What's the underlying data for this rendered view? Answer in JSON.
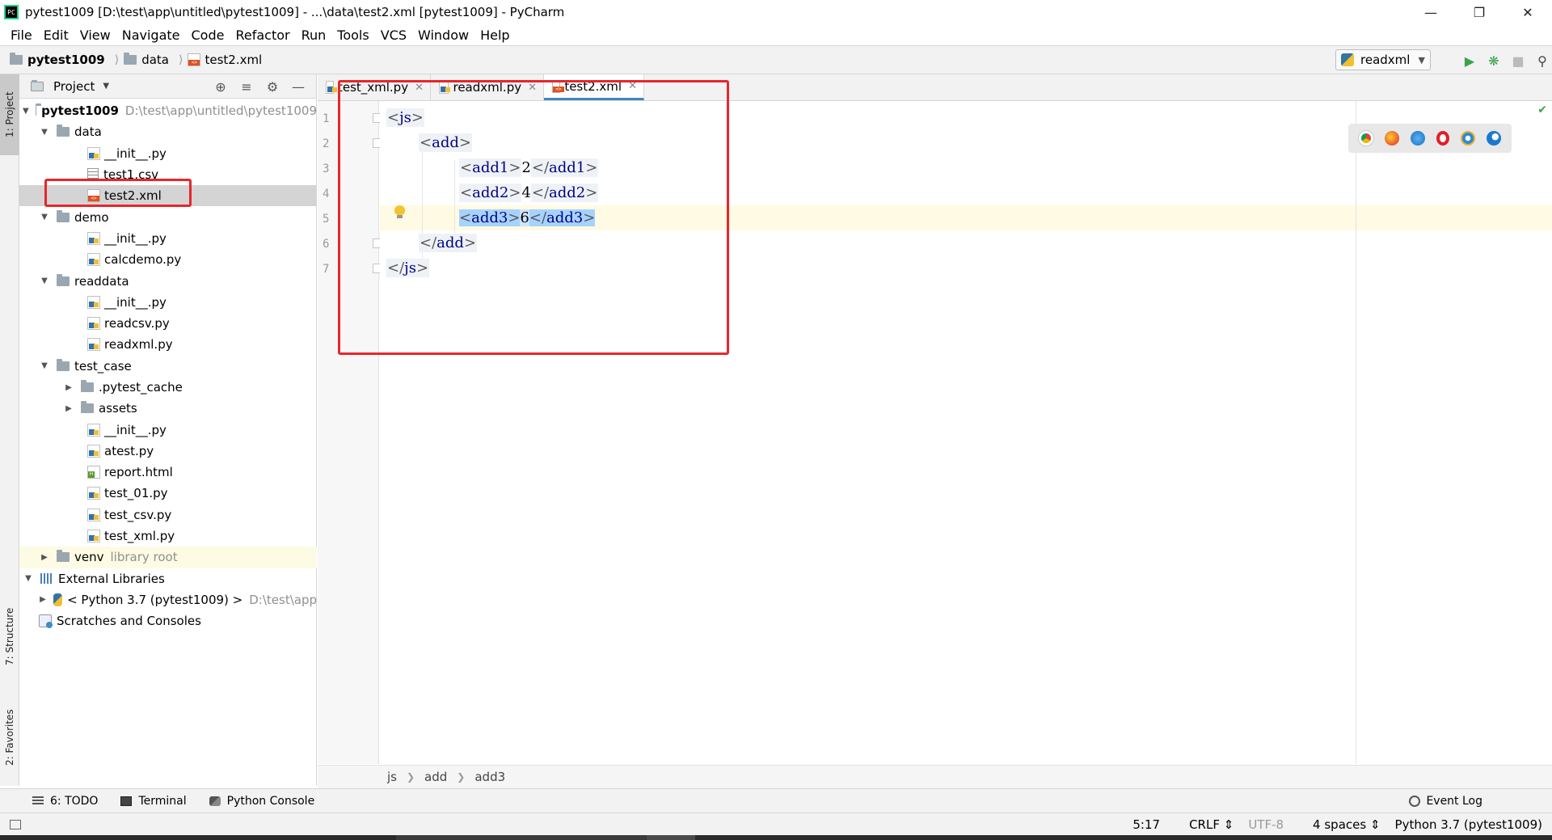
{
  "window": {
    "title": "pytest1009 [D:\\test\\app\\untitled\\pytest1009] - ...\\data\\test2.xml [pytest1009] - PyCharm",
    "app_icon": "PC",
    "controls": [
      "minimize-icon",
      "restore-icon",
      "close-icon"
    ]
  },
  "menu": [
    "File",
    "Edit",
    "View",
    "Navigate",
    "Code",
    "Refactor",
    "Run",
    "Tools",
    "VCS",
    "Window",
    "Help"
  ],
  "navbar": {
    "crumbs": [
      "pytest1009",
      "data",
      "test2.xml"
    ],
    "run_config": "readxml"
  },
  "left_strip": {
    "project": "1: Project",
    "structure": "7: Structure",
    "favorites": "2: Favorites"
  },
  "project_panel": {
    "title": "Project",
    "tree": {
      "root": "pytest1009",
      "root_path": "D:\\test\\app\\untitled\\pytest1009",
      "data": "data",
      "data_init": "__init__.py",
      "data_csv": "test1.csv",
      "data_xml": "test2.xml",
      "demo": "demo",
      "demo_init": "__init__.py",
      "demo_calc": "calcdemo.py",
      "readdata": "readdata",
      "readdata_init": "__init__.py",
      "readdata_csv": "readcsv.py",
      "readdata_xml": "readxml.py",
      "test_case": "test_case",
      "pytest_cache": ".pytest_cache",
      "assets": "assets",
      "tc_init": "__init__.py",
      "atest": "atest.py",
      "report": "report.html",
      "test01": "test_01.py",
      "testcsv": "test_csv.py",
      "testxml": "test_xml.py",
      "venv": "venv",
      "venv_note": "library root",
      "ext_libs": "External Libraries",
      "python": "< Python 3.7 (pytest1009) >",
      "python_path": "D:\\test\\app",
      "scratches": "Scratches and Consoles"
    }
  },
  "editor": {
    "tabs": [
      "test_xml.py",
      "readxml.py",
      "test2.xml"
    ],
    "active_tab": "test2.xml",
    "line_numbers": [
      "1",
      "2",
      "3",
      "4",
      "5",
      "6",
      "7"
    ],
    "code": {
      "l1_open": "<",
      "l1_tag": "js",
      "l1_close": ">",
      "l2_tag": "add",
      "l3_tag": "add1",
      "l3_val": "2",
      "l4_tag": "add2",
      "l4_val": "4",
      "l5_tag": "add3",
      "l5_val": "6",
      "l6_tag": "add",
      "l7_tag": "js"
    },
    "breadcrumbs": [
      "js",
      "add",
      "add3"
    ],
    "browsers": [
      "chrome-icon",
      "firefox-icon",
      "safari-icon",
      "opera-icon",
      "ie-icon",
      "edge-icon"
    ]
  },
  "bottom_tools": {
    "todo": "6: TODO",
    "terminal": "Terminal",
    "python_console": "Python Console",
    "event_log": "Event Log"
  },
  "status": {
    "position": "5:17",
    "line_sep": "CRLF",
    "encoding": "UTF-8",
    "indent": "4 spaces",
    "interpreter": "Python 3.7 (pytest1009)"
  },
  "colors": {
    "highlight_box": "#e8262b",
    "selection": "#a6d2ff",
    "current_line": "#fffae3",
    "xml_tag": "#000080"
  }
}
